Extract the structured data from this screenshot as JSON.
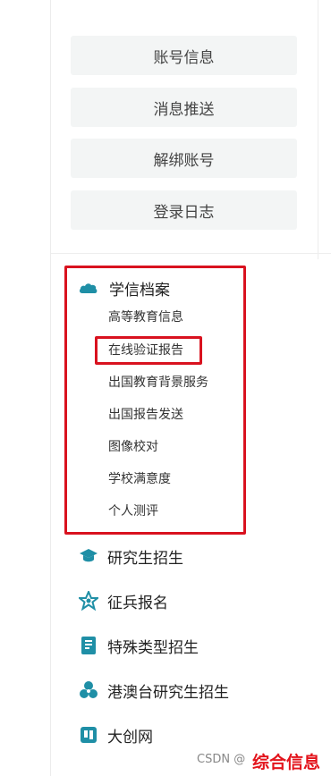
{
  "account_menu": [
    {
      "label": "账号信息"
    },
    {
      "label": "消息推送"
    },
    {
      "label": "解绑账号"
    },
    {
      "label": "登录日志"
    }
  ],
  "xuexin_section": {
    "title": "学信档案",
    "icon": "cloud-icon",
    "items": [
      {
        "label": "高等教育信息"
      },
      {
        "label": "在线验证报告"
      },
      {
        "label": "出国教育背景服务"
      },
      {
        "label": "出国报告发送"
      },
      {
        "label": "图像校对"
      },
      {
        "label": "学校满意度"
      },
      {
        "label": "个人测评"
      }
    ]
  },
  "nav": [
    {
      "label": "研究生招生",
      "icon": "graduation-cap-icon"
    },
    {
      "label": "征兵报名",
      "icon": "star-badge-icon"
    },
    {
      "label": "特殊类型招生",
      "icon": "book-icon"
    },
    {
      "label": "港澳台研究生招生",
      "icon": "flower-icon"
    },
    {
      "label": "大创网",
      "icon": "create-icon"
    }
  ],
  "watermark": {
    "csdn": "CSDN @",
    "brand": "综合信息"
  },
  "colors": {
    "accent": "#1f8fa6",
    "highlight": "#d9121f",
    "button_bg": "#f3f5f5"
  }
}
